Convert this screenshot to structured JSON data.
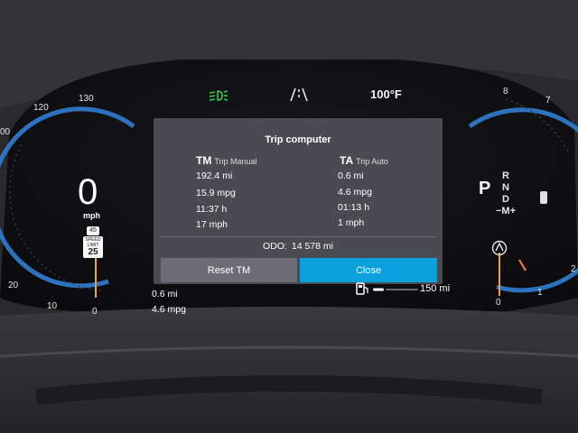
{
  "cluster": {
    "speedometer": {
      "ticks": [
        "130",
        "120",
        "00",
        "20",
        "10",
        "0"
      ],
      "speed": "0",
      "unit": "mph",
      "route_sign": "45",
      "limit_sign": {
        "top": "SPEED",
        "middle": "LIMIT",
        "value": "25"
      }
    },
    "tachometer": {
      "ticks": [
        "8",
        "7",
        "2",
        "1",
        "0"
      ]
    },
    "top_bar": {
      "headlight_icon": "low-beam-headlight-icon",
      "lane_icon": "lane-assist-icon",
      "outside_temp": "100°F",
      "headlight_color": "#3cc84a"
    },
    "gear": {
      "selected": "P",
      "options": [
        "R",
        "N",
        "D"
      ],
      "manual": "−M+"
    },
    "below_panel": {
      "distance": "0.6 mi",
      "economy": "4.6 mpg",
      "range": "150 mi",
      "fuel_icon": "fuel-pump-icon"
    }
  },
  "trip_computer": {
    "title": "Trip computer",
    "manual": {
      "code": "TM",
      "label": "Trip Manual",
      "distance": "192.4 mi",
      "economy": "15.9 mpg",
      "time": "11:37 h",
      "avg_speed": "17 mph"
    },
    "auto": {
      "code": "TA",
      "label": "Trip Auto",
      "distance": "0.6 mi",
      "economy": "4.6 mpg",
      "time": "01:13 h",
      "avg_speed": "1 mph"
    },
    "odometer": {
      "label": "ODO:",
      "value": "14 578 mi"
    },
    "buttons": {
      "reset": "Reset TM",
      "close": "Close"
    }
  },
  "colors": {
    "accent": "#0aa0dc",
    "gauge_blue": "#2f78c8",
    "needle": "#f0a040",
    "panel_bg": "#4a4a52"
  }
}
